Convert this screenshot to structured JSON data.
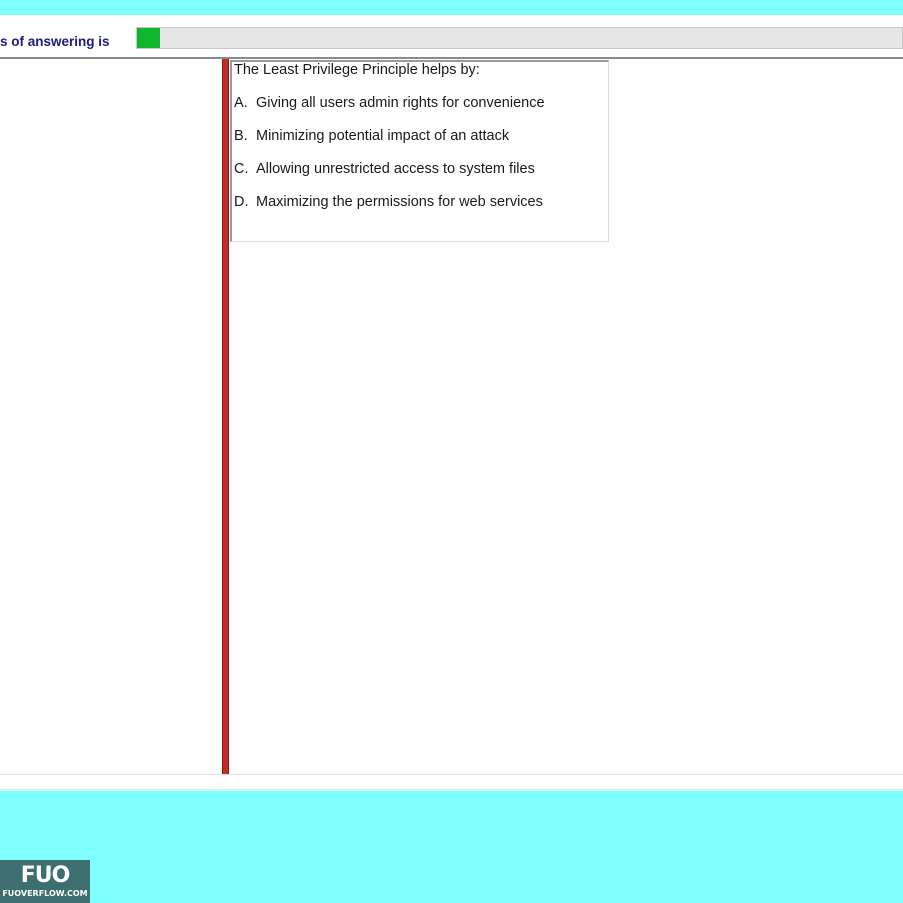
{
  "progress": {
    "label": "s of answering is",
    "fill_fraction": 0.03,
    "fill_color": "#0fb52d"
  },
  "question": {
    "text": "The Least Privilege Principle helps by:",
    "options": [
      {
        "letter": "A.",
        "text": "Giving all users admin rights for convenience"
      },
      {
        "letter": "B.",
        "text": "Minimizing potential impact of an attack"
      },
      {
        "letter": "C.",
        "text": "Allowing unrestricted access to system files"
      },
      {
        "letter": "D.",
        "text": "Maximizing the permissions for web services"
      }
    ]
  },
  "colors": {
    "band": "#80ffff",
    "splitter": "#c42b2b",
    "label": "#1a1a80"
  },
  "watermark": {
    "mark": "FUO",
    "text": "FUOVERFLOW.COM"
  }
}
